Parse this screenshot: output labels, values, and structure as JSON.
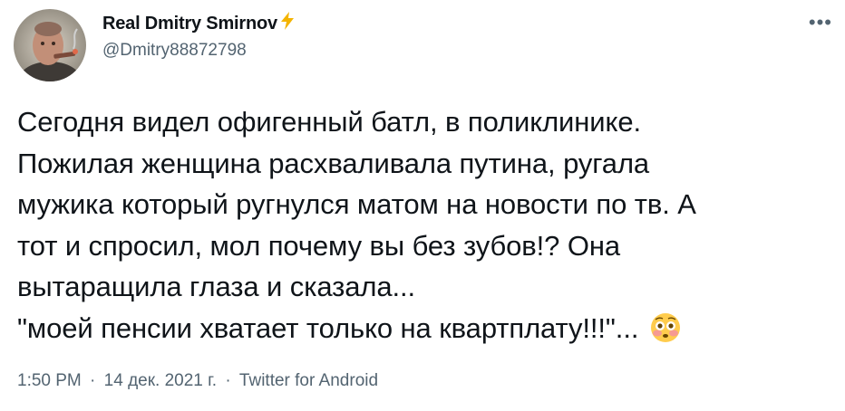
{
  "tweet": {
    "display_name": "Real Dmitry Smirnov",
    "handle": "@Dmitry88872798",
    "more_icon": "more-horizontal-icon",
    "text_lines": [
      "Сегодня видел офигенный батл, в поликлинике.",
      "Пожилая женщина расхваливала путина, ругала",
      "мужика который ругнулся матом на новости по тв. А",
      "тот и спросил, мол почему вы без зубов!? Она",
      "вытаращила глаза и сказала...",
      "\"моей пенсии хватает только на квартплату!!!\"..."
    ],
    "time": "1:50 PM",
    "date": "14 дек. 2021 г.",
    "source": "Twitter for Android",
    "separator": "·",
    "colors": {
      "text": "#0f1419",
      "secondary": "#536471",
      "bolt": "#f4b400"
    }
  }
}
